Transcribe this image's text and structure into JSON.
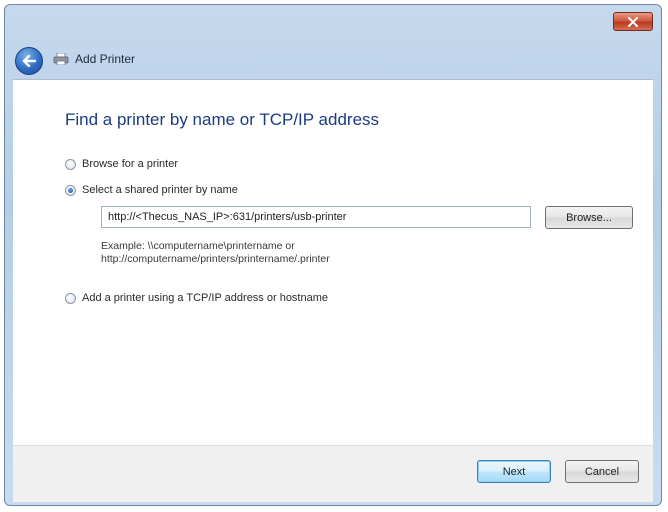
{
  "window": {
    "close_icon": "close-icon",
    "accent_color": "#1c3b84"
  },
  "nav": {
    "back_icon": "back-arrow-icon",
    "printer_icon": "printer-icon",
    "title": "Add Printer"
  },
  "main": {
    "heading": "Find a printer by name or TCP/IP address",
    "options": [
      {
        "label": "Browse for a printer",
        "selected": false
      },
      {
        "label": "Select a shared printer by name",
        "selected": true
      },
      {
        "label": "Add a printer using a TCP/IP address or hostname",
        "selected": false
      }
    ],
    "url_value": "http://<Thecus_NAS_IP>:631/printers/usb-printer",
    "browse_label": "Browse...",
    "example_line1": "Example: \\\\computername\\printername or",
    "example_line2": "http://computername/printers/printername/.printer"
  },
  "footer": {
    "next_label": "Next",
    "cancel_label": "Cancel"
  }
}
